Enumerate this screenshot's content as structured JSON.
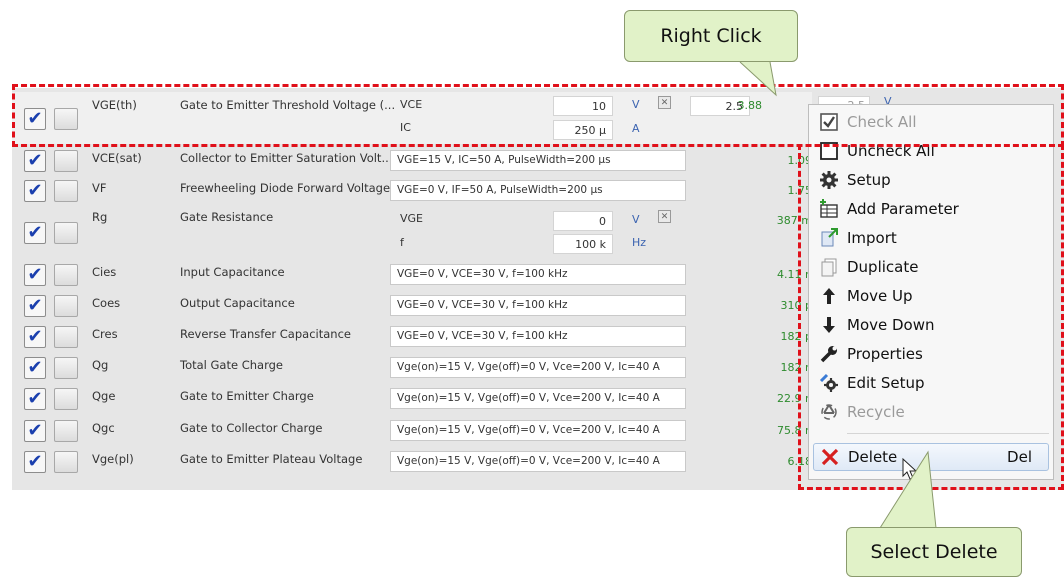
{
  "rows": [
    {
      "checked": true,
      "symbol": "VGE(th)",
      "description": "Gate to Emitter Threshold Voltage (...",
      "params": [
        {
          "name": "VCE",
          "value": "10",
          "unit": "V"
        },
        {
          "name": "IC",
          "value": "250 μ",
          "unit": "A"
        }
      ],
      "limit": "2.5",
      "result": "3.88",
      "extra_field": "2.5",
      "extra_unit": "V"
    },
    {
      "checked": true,
      "symbol": "VCE(sat)",
      "description": "Collector to Emitter Saturation Volt...",
      "condition": "VGE=15 V, IC=50 A, PulseWidth=200 μs",
      "result": "1.09"
    },
    {
      "checked": true,
      "symbol": "VF",
      "description": "Freewheeling Diode Forward Voltage",
      "condition": "VGE=0 V, IF=50 A, PulseWidth=200 μs",
      "result": "1.75"
    },
    {
      "checked": true,
      "symbol": "Rg",
      "description": "Gate Resistance",
      "params": [
        {
          "name": "VGE",
          "value": "0",
          "unit": "V"
        },
        {
          "name": "f",
          "value": "100 k",
          "unit": "Hz"
        }
      ],
      "result": "387 m"
    },
    {
      "checked": true,
      "symbol": "Cies",
      "description": "Input Capacitance",
      "condition": "VGE=0 V, VCE=30 V, f=100 kHz",
      "result": "4.11 n"
    },
    {
      "checked": true,
      "symbol": "Coes",
      "description": "Output Capacitance",
      "condition": "VGE=0 V, VCE=30 V, f=100 kHz",
      "result": "310 p"
    },
    {
      "checked": true,
      "symbol": "Cres",
      "description": "Reverse Transfer Capacitance",
      "condition": "VGE=0 V, VCE=30 V, f=100 kHz",
      "result": "182 p"
    },
    {
      "checked": true,
      "symbol": "Qg",
      "description": "Total Gate Charge",
      "condition": "Vge(on)=15 V, Vge(off)=0 V, Vce=200 V, Ic=40 A",
      "result": "182 n"
    },
    {
      "checked": true,
      "symbol": "Qge",
      "description": "Gate to Emitter Charge",
      "condition": "Vge(on)=15 V, Vge(off)=0 V, Vce=200 V, Ic=40 A",
      "result": "22.9 n"
    },
    {
      "checked": true,
      "symbol": "Qgc",
      "description": "Gate to Collector Charge",
      "condition": "Vge(on)=15 V, Vge(off)=0 V, Vce=200 V, Ic=40 A",
      "result": "75.8 n"
    },
    {
      "checked": true,
      "symbol": "Vge(pl)",
      "description": "Gate to Emitter Plateau Voltage",
      "condition": "Vge(on)=15 V, Vge(off)=0 V, Vce=200 V, Ic=40 A",
      "result": "6.18"
    }
  ],
  "context_menu": {
    "items": [
      {
        "label": "Check All",
        "icon": "checkbox-checked-icon",
        "disabled": true
      },
      {
        "label": "Uncheck All",
        "icon": "checkbox-empty-icon",
        "disabled": false
      },
      {
        "label": "Setup",
        "icon": "gear-icon",
        "disabled": false
      },
      {
        "label": "Add Parameter",
        "icon": "add-parameter-icon",
        "disabled": false
      },
      {
        "label": "Import",
        "icon": "import-icon",
        "disabled": false
      },
      {
        "label": "Duplicate",
        "icon": "duplicate-icon",
        "disabled": false
      },
      {
        "label": "Move Up",
        "icon": "arrow-up-icon",
        "disabled": false
      },
      {
        "label": "Move Down",
        "icon": "arrow-down-icon",
        "disabled": false
      },
      {
        "label": "Properties",
        "icon": "wrench-icon",
        "disabled": false
      },
      {
        "label": "Edit Setup",
        "icon": "edit-setup-icon",
        "disabled": false
      },
      {
        "label": "Recycle",
        "icon": "recycle-icon",
        "disabled": true
      }
    ],
    "delete_item": {
      "label": "Delete",
      "shortcut": "Del",
      "icon": "delete-x-icon",
      "highlighted": true
    }
  },
  "callouts": {
    "right_click": "Right Click",
    "select_delete": "Select Delete"
  },
  "colors": {
    "highlight_dash": "#e0101a",
    "callout_fill": "#e1f2c8",
    "result_text": "#2e8b2e",
    "delete_icon": "#d62020"
  }
}
